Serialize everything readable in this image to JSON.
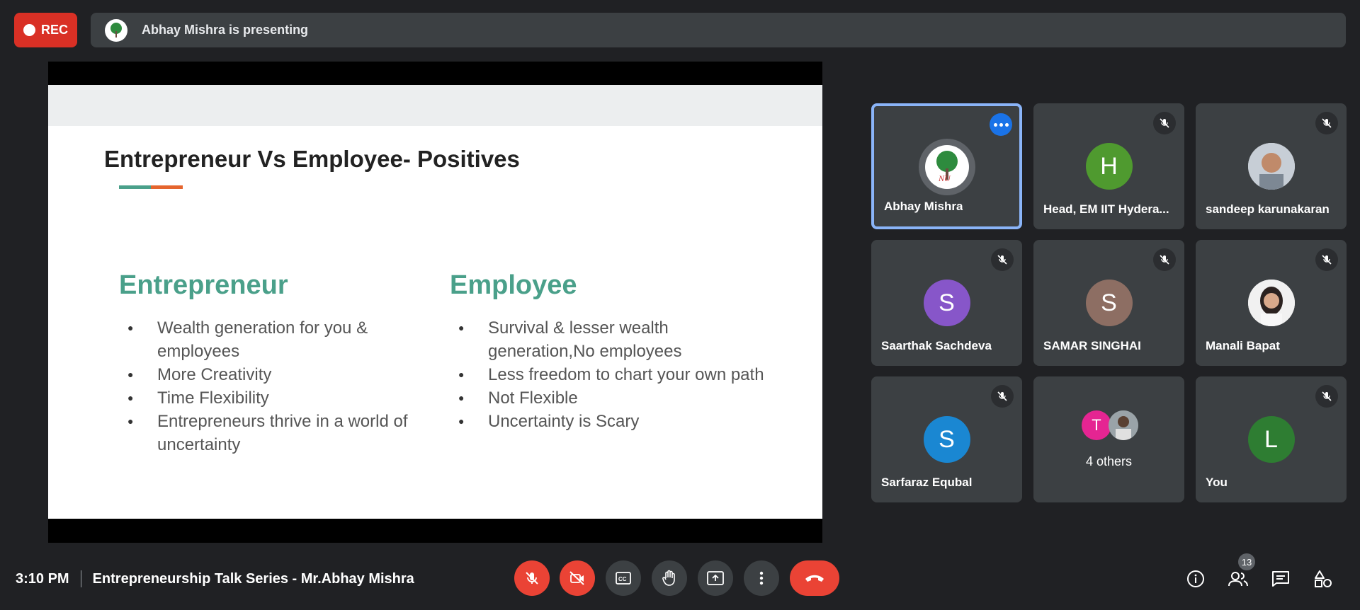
{
  "top": {
    "rec_label": "REC",
    "presenting_text": "Abhay Mishra is presenting"
  },
  "slide": {
    "title": "Entrepreneur Vs Employee- Positives",
    "accent_colors": [
      "#4aa08a",
      "#e5652e"
    ],
    "columns": [
      {
        "heading": "Entrepreneur",
        "items": [
          "Wealth generation for you & employees",
          "More Creativity",
          "Time Flexibility",
          "Entrepreneurs thrive in a world of uncertainty"
        ]
      },
      {
        "heading": "Employee",
        "items": [
          "Survival & lesser wealth generation,No employees",
          "Less freedom to chart your own path",
          "Not Flexible",
          "Uncertainty is Scary"
        ]
      }
    ]
  },
  "participants": [
    {
      "name": "Abhay Mishra",
      "avatar": "logo",
      "active": true
    },
    {
      "name": "Head, EM IIT Hydera...",
      "initial": "H",
      "color": "#4f9a2f",
      "muted": true
    },
    {
      "name": "sandeep karunakaran",
      "avatar": "photo",
      "muted": true
    },
    {
      "name": "Saarthak Sachdeva",
      "initial": "S",
      "color": "#8756c9",
      "muted": true
    },
    {
      "name": "SAMAR SINGHAI",
      "initial": "S",
      "color": "#8d6e63",
      "muted": true
    },
    {
      "name": "Manali Bapat",
      "avatar": "photo",
      "muted": true
    },
    {
      "name": "Sarfaraz Equbal",
      "initial": "S",
      "color": "#1a87d2",
      "muted": true
    },
    {
      "name": "4 others",
      "initial": "T",
      "color": "#e52592"
    },
    {
      "name": "You",
      "initial": "L",
      "color": "#2e7d32",
      "muted": true
    }
  ],
  "bottom": {
    "time": "3:10 PM",
    "meeting_title": "Entrepreneurship Talk Series - Mr.Abhay Mishra",
    "people_count": "13"
  }
}
